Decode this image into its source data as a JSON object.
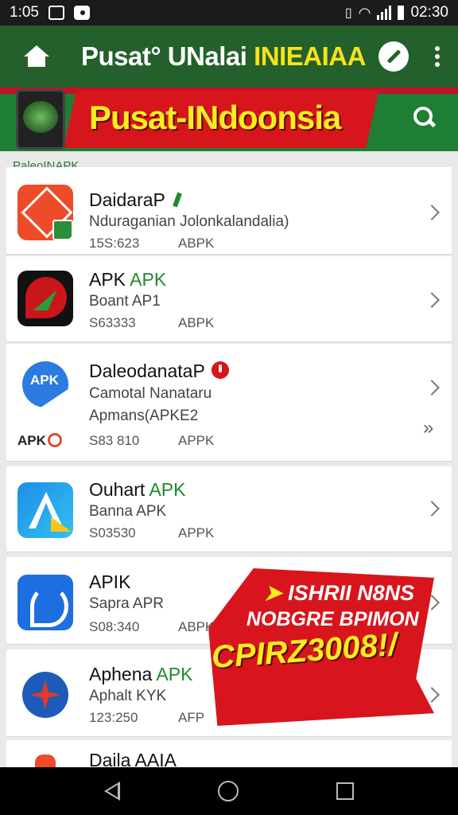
{
  "status_bar": {
    "time_left": "1:05",
    "time_right": "02:30"
  },
  "toolbar": {
    "title_white": "Pusat° UNalai ",
    "title_yellow": "INIEAIAA"
  },
  "banner": {
    "text": "Pusat-INdoonsia"
  },
  "list": {
    "section_label": "PaleoINAPK",
    "items": [
      {
        "name": "DaidaraP",
        "name_suffix": "",
        "desc": "Nduraganian Jolonkalandalia)",
        "desc2": "",
        "size": "15S:623",
        "type": "ABPK",
        "icon": "red-app-icon"
      },
      {
        "name": "APK ",
        "name_suffix": "APK",
        "desc": "Boant AP1",
        "desc2": "",
        "size": "S63333",
        "type": "ABPK",
        "icon": "flag-app-icon"
      },
      {
        "name": "DaleodanataP",
        "name_suffix": "",
        "desc": "Camotal Nanataru",
        "desc2": "Apmans(APKE2",
        "size": "S83 810",
        "type": "APPK",
        "icon": "apk-blue-app-icon",
        "tag": "APK"
      },
      {
        "name": "Ouhart ",
        "name_suffix": "APK",
        "desc": "Banna APK",
        "desc2": "",
        "size": "S03530",
        "type": "APPK",
        "icon": "triangle-app-icon"
      },
      {
        "name": "APIK",
        "name_suffix": "",
        "desc": "Sapra APR",
        "desc2": "",
        "size": "S08:340",
        "type": "ABPK",
        "icon": "blue-app-icon"
      },
      {
        "name": "Aphena ",
        "name_suffix": "APK",
        "desc": "Aphalt KYK",
        "desc2": "",
        "size": "123:250",
        "type": "AFP",
        "icon": "compass-app-icon"
      },
      {
        "name": "Daila AAIA",
        "name_suffix": "",
        "desc": "",
        "desc2": "",
        "size": "",
        "type": "",
        "icon": "partial-app-icon"
      }
    ]
  },
  "promo": {
    "arrow": "➤",
    "line1": "ISHRII N8NS",
    "line2": "NOBGRE BPIMON",
    "line3": "CPIRZ3008!/"
  },
  "colors": {
    "toolbar": "#23602b",
    "accent_green": "#1f8a2c",
    "promo_red": "#d8151d",
    "promo_yellow": "#f8ec21"
  }
}
